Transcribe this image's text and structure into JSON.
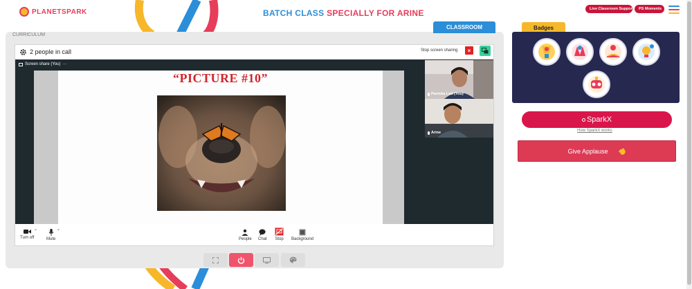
{
  "header": {
    "logo_text": "PLANETSPARK",
    "title_part1": "BATCH CLASS",
    "title_part2": "SPECIALLY FOR ARINE",
    "live_support_label": "Live Classroom Support",
    "moments_label": "PS Moments"
  },
  "main": {
    "curriculum_label": "CURRICULUM",
    "classroom_tab": "CLASSROOM"
  },
  "call": {
    "people_count": "2 people in call",
    "stop_sharing": "Stop screen sharing",
    "stop_x": "×",
    "screen_share_label": "Screen share (You)",
    "screen_share_more": "···",
    "slide_title": "“PICTURE #10”",
    "participants": [
      {
        "name": "Parmita Lad (You)"
      },
      {
        "name": "Arine"
      }
    ],
    "toolbar": {
      "camera": "Turn off",
      "mic": "Mute",
      "people": "People",
      "chat": "Chat",
      "stop": "Stop",
      "background": "Background"
    }
  },
  "sidebar": {
    "badges_title": "Badges",
    "sparkx_label": "SparkX",
    "sparkx_link": "How SparkX works",
    "applause_label": "Give Applause"
  },
  "colors": {
    "brand_red": "#e73c5a",
    "brand_blue": "#2b8ed8",
    "brand_yellow": "#f6b82a",
    "badges_bg": "#262850",
    "sparkx": "#d9164b"
  },
  "icons": [
    "logo-icon",
    "gear-icon",
    "switch-icon",
    "camera-icon",
    "mic-icon",
    "people-icon",
    "chat-icon",
    "stop-icon",
    "background-icon",
    "fullscreen-icon",
    "power-icon",
    "present-icon",
    "palette-icon",
    "clap-icon"
  ]
}
